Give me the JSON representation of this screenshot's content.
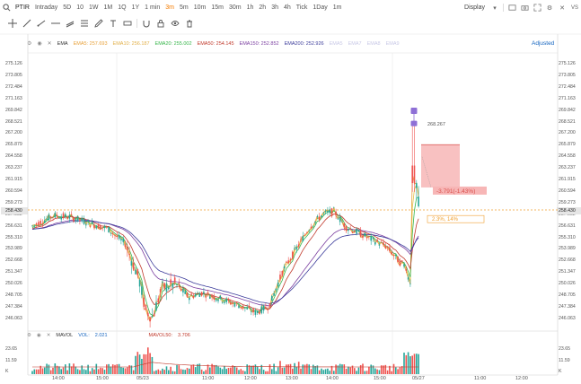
{
  "symbol": "PTIR",
  "timeframes": [
    "Intraday",
    "5D",
    "10",
    "1W",
    "1M",
    "1Q",
    "1Y",
    "1 min",
    "3m",
    "5m",
    "10m",
    "15m",
    "30m",
    "1h",
    "2h",
    "3h",
    "4h",
    "Tick",
    "1Day",
    "1m"
  ],
  "active_timeframe": "3m",
  "display_label": "Display",
  "adjusted_label": "Adjusted",
  "ema_legend": {
    "name": "EMA",
    "items": [
      {
        "label": "EMA5:",
        "value": "257.693",
        "color": "#e8a23b"
      },
      {
        "label": "EMA10:",
        "value": "256.187",
        "color": "#e2b04a"
      },
      {
        "label": "EMA20:",
        "value": "255.002",
        "color": "#36b54a"
      },
      {
        "label": "EMA50:",
        "value": "254.145",
        "color": "#c0392b"
      },
      {
        "label": "EMA150:",
        "value": "252.852",
        "color": "#7b3fa0"
      },
      {
        "label": "EMA200:",
        "value": "252.926",
        "color": "#3b3b9a"
      }
    ],
    "faded": [
      "EMA5",
      "EMA7",
      "EMA8",
      "EMA9"
    ]
  },
  "price_axis": [
    "275.126",
    "273.805",
    "272.484",
    "271.163",
    "269.842",
    "268.521",
    "267.200",
    "265.879",
    "264.558",
    "263.237",
    "261.915",
    "260.594",
    "259.273",
    "257.952",
    "256.631",
    "255.310",
    "253.989",
    "252.668",
    "251.347",
    "250.026",
    "248.705",
    "247.384",
    "246.063"
  ],
  "current_price": "258.430",
  "marker_price": "268.267",
  "range_label": "-3.791(-1.43%)",
  "position_label": "2.3%, 14%",
  "mavol_legend": {
    "name": "MAVOL",
    "vol_label": "VOL:",
    "vol_value": "2.021",
    "ma_label": "MAVOL50:",
    "ma_value": "3.706"
  },
  "vol_axis": [
    "23.65",
    "11.59",
    "K"
  ],
  "time_axis": [
    "14:00",
    "15:00",
    "05/23",
    "11:00",
    "12:00",
    "13:00",
    "14:00",
    "15:00",
    "05/27",
    "11:00",
    "12:00"
  ],
  "colors": {
    "up": "#26a69a",
    "down": "#ef5350",
    "accent": "#f57c00"
  },
  "chart_data": {
    "type": "candlestick",
    "ema_lines": [
      "EMA5",
      "EMA10",
      "EMA20",
      "EMA50",
      "EMA150",
      "EMA200"
    ],
    "ylim": [
      246.063,
      275.126
    ],
    "last_price": 258.43
  }
}
